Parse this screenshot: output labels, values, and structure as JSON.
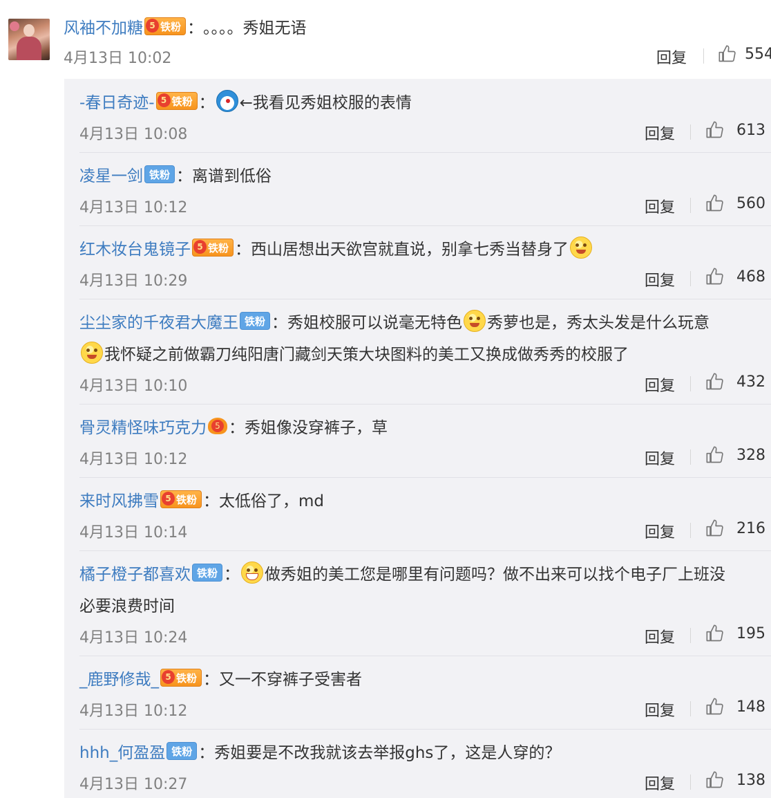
{
  "top_comment": {
    "username": "风袖不加糖",
    "badge": "铁粉",
    "separator": "：",
    "text": "。。。。秀姐无语",
    "time": "4月13日 10:02",
    "reply_label": "回复",
    "likes": "554"
  },
  "replies": [
    {
      "username": "-春日奇迹-",
      "badge_type": "gold",
      "badge": "铁粉",
      "sep": "：",
      "emoji_before": "doraemon",
      "text": "←我看见秀姐校服的表情",
      "time": "4月13日 10:08",
      "reply_label": "回复",
      "likes": "613"
    },
    {
      "username": "凌星一剑",
      "badge_type": "blue",
      "badge": "铁粉",
      "sep": "：",
      "text": "离谱到低俗",
      "time": "4月13日 10:12",
      "reply_label": "回复",
      "likes": "560"
    },
    {
      "username": "红木妆台鬼镜子",
      "badge_type": "gold",
      "badge": "铁粉",
      "sep": "：",
      "text": "西山居想出天欲宫就直说，别拿七秀当替身了",
      "emoji_after": "yellow",
      "time": "4月13日 10:29",
      "reply_label": "回复",
      "likes": "468"
    },
    {
      "username": "尘尘家的千夜君大魔王",
      "badge_type": "blue",
      "badge": "铁粉",
      "sep": "：",
      "text_a": "秀姐校服可以说毫无特色",
      "text_b": "秀萝也是，秀太头发是什么玩意",
      "text_line2": "我怀疑之前做霸刀纯阳唐门藏剑天策大块图料的美工又换成做秀秀的校服了",
      "time": "4月13日 10:10",
      "reply_label": "回复",
      "likes": "432"
    },
    {
      "username": "骨灵精怪味巧克力",
      "badge_type": "crest",
      "sep": "：",
      "text": "秀姐像没穿裤子，草",
      "time": "4月13日 10:12",
      "reply_label": "回复",
      "likes": "328"
    },
    {
      "username": "来时风拂雪",
      "badge_type": "gold",
      "badge": "铁粉",
      "sep": "：",
      "text": "太低俗了，md",
      "time": "4月13日 10:14",
      "reply_label": "回复",
      "likes": "216"
    },
    {
      "username": "橘子橙子都喜欢",
      "badge_type": "blue",
      "badge": "铁粉",
      "sep": "：",
      "text": "做秀姐的美工您是哪里有问题吗？做不出来可以找个电子厂上班没",
      "text_line2": "必要浪费时间",
      "time": "4月13日 10:24",
      "reply_label": "回复",
      "likes": "195"
    },
    {
      "username": "_鹿野修哉_",
      "badge_type": "gold",
      "badge": "铁粉",
      "sep": "：",
      "text": "又一不穿裤子受害者",
      "time": "4月13日 10:12",
      "reply_label": "回复",
      "likes": "148"
    },
    {
      "username": "hhh_何盈盈",
      "badge_type": "blue",
      "badge": "铁粉",
      "sep": "：",
      "text": "秀姐要是不改我就该去举报ghs了，这是人穿的？",
      "time": "4月13日 10:27",
      "reply_label": "回复",
      "likes": "138"
    }
  ]
}
